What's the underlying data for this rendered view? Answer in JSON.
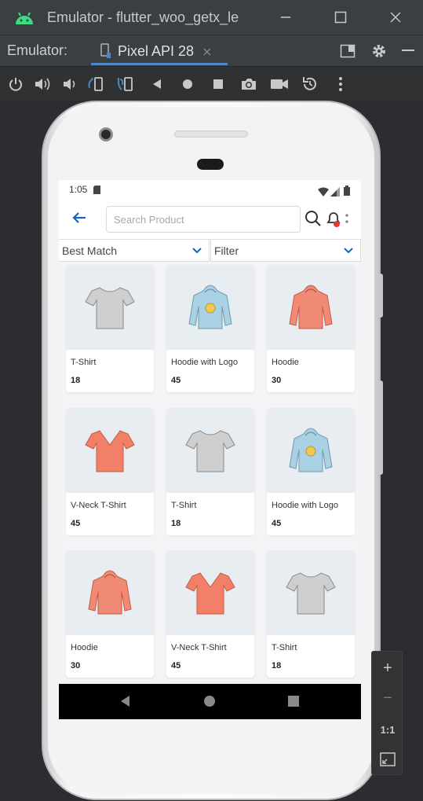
{
  "window": {
    "title": "Emulator - flutter_woo_getx_le"
  },
  "tabbar": {
    "label": "Emulator:",
    "active_tab": "Pixel API 28",
    "close_glyph": "×"
  },
  "toolbar": {
    "icons": [
      "power-icon",
      "volume-up-icon",
      "volume-down-icon",
      "rotate-left-icon",
      "rotate-right-icon",
      "back-icon",
      "home-icon",
      "overview-icon",
      "camera-icon",
      "record-icon",
      "snapshot-icon",
      "more-icon"
    ]
  },
  "phone": {
    "status": {
      "time": "1:05"
    },
    "search": {
      "placeholder": "Search Product"
    },
    "filters": {
      "sort_label": "Best Match",
      "filter_label": "Filter"
    },
    "accent_color": "#1565c0",
    "products": [
      {
        "name": "T-Shirt",
        "price": "18",
        "kind": "tshirt",
        "color": "#cfcfcf"
      },
      {
        "name": "Hoodie with Logo",
        "price": "45",
        "kind": "hoodie-logo",
        "color": "#a9d0e3"
      },
      {
        "name": "Hoodie",
        "price": "30",
        "kind": "hoodie",
        "color": "#f08a74"
      },
      {
        "name": "V-Neck T-Shirt",
        "price": "45",
        "kind": "vneck",
        "color": "#f27f68"
      },
      {
        "name": "T-Shirt",
        "price": "18",
        "kind": "tshirt",
        "color": "#cfcfcf"
      },
      {
        "name": "Hoodie with Logo",
        "price": "45",
        "kind": "hoodie-logo",
        "color": "#a9d0e3"
      },
      {
        "name": "Hoodie",
        "price": "30",
        "kind": "hoodie",
        "color": "#f08a74"
      },
      {
        "name": "V-Neck T-Shirt",
        "price": "45",
        "kind": "vneck",
        "color": "#f27f68"
      },
      {
        "name": "T-Shirt",
        "price": "18",
        "kind": "tshirt",
        "color": "#cfcfcf"
      }
    ]
  },
  "zoom": {
    "plus": "+",
    "minus": "−",
    "ratio": "1:1"
  }
}
